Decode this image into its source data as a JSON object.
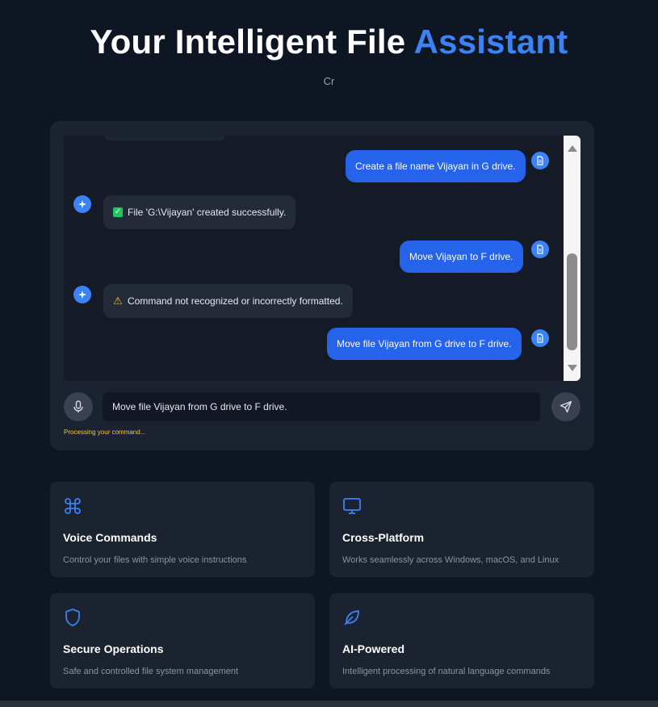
{
  "header": {
    "title_main": "Your Intelligent File",
    "title_accent": "Assistant",
    "subtitle": "Cr"
  },
  "chat": {
    "messages": [
      {
        "role": "user",
        "text": "Create a file name Vijayan in G drive."
      },
      {
        "role": "bot",
        "status": "success",
        "text": "File 'G:\\Vijayan' created successfully."
      },
      {
        "role": "user",
        "text": "Move Vijayan to F drive."
      },
      {
        "role": "bot",
        "status": "warning",
        "text": "Command not recognized or incorrectly formatted."
      },
      {
        "role": "user",
        "text": "Move file Vijayan from G drive to F drive."
      }
    ],
    "input_value": "Move file Vijayan from G drive to F drive.",
    "status_text": "Processing your command..."
  },
  "features": [
    {
      "icon": "command-icon",
      "title": "Voice Commands",
      "description": "Control your files with simple voice instructions"
    },
    {
      "icon": "monitor-icon",
      "title": "Cross-Platform",
      "description": "Works seamlessly across Windows, macOS, and Linux"
    },
    {
      "icon": "shield-icon",
      "title": "Secure Operations",
      "description": "Safe and controlled file system management"
    },
    {
      "icon": "leaf-icon",
      "title": "AI-Powered",
      "description": "Intelligent processing of natural language commands"
    }
  ],
  "colors": {
    "background": "#0f1623",
    "card": "#1c2330",
    "accent": "#3b82f6",
    "user_bubble": "#2563eb",
    "status": "#f5c542"
  }
}
